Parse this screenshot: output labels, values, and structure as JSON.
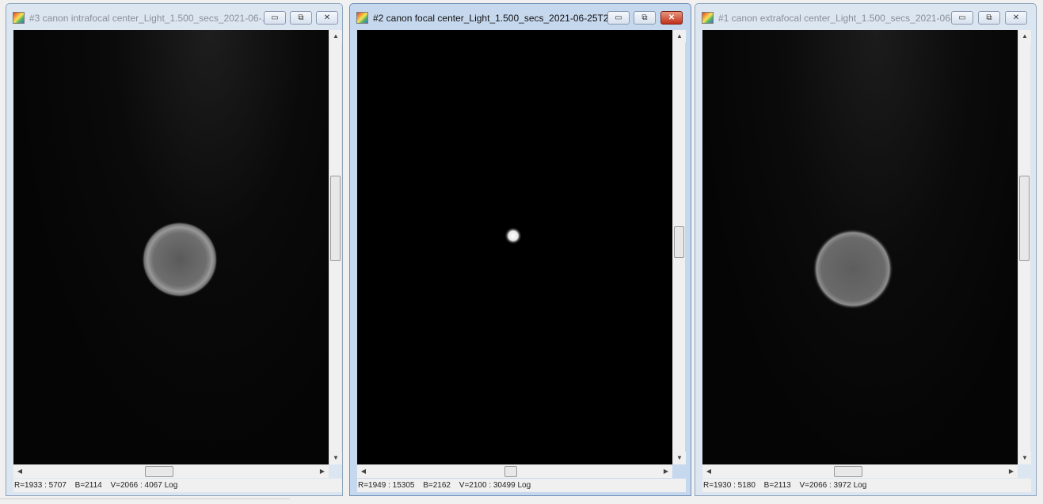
{
  "windows": [
    {
      "title": "#3 canon intrafocal center_Light_1.500_secs_2021-06-...",
      "status": {
        "r": "R=1933 : 5707",
        "b": "B=2114",
        "v": "V=2066 : 4067 Log"
      },
      "active": false,
      "star": "defocused-donut-ring"
    },
    {
      "title": "#2 canon focal center_Light_1.500_secs_2021-06-25T2...",
      "status": {
        "r": "R=1949 : 15305",
        "b": "B=2162",
        "v": "V=2100 : 30499 Log"
      },
      "active": true,
      "star": "focused-point"
    },
    {
      "title": "#1 canon extrafocal center_Light_1.500_secs_2021-06-...",
      "status": {
        "r": "R=1930 : 5180",
        "b": "B=2113",
        "v": "V=2066 : 3972 Log"
      },
      "active": false,
      "star": "defocused-disc"
    }
  ],
  "icons": {
    "minimize": "minimize-icon",
    "maximize": "restore-icon",
    "close": "close-icon"
  },
  "glyphs": {
    "min": "▭",
    "max": "⧉",
    "close": "✕",
    "up": "▲",
    "down": "▼",
    "left": "◀",
    "right": "▶"
  }
}
